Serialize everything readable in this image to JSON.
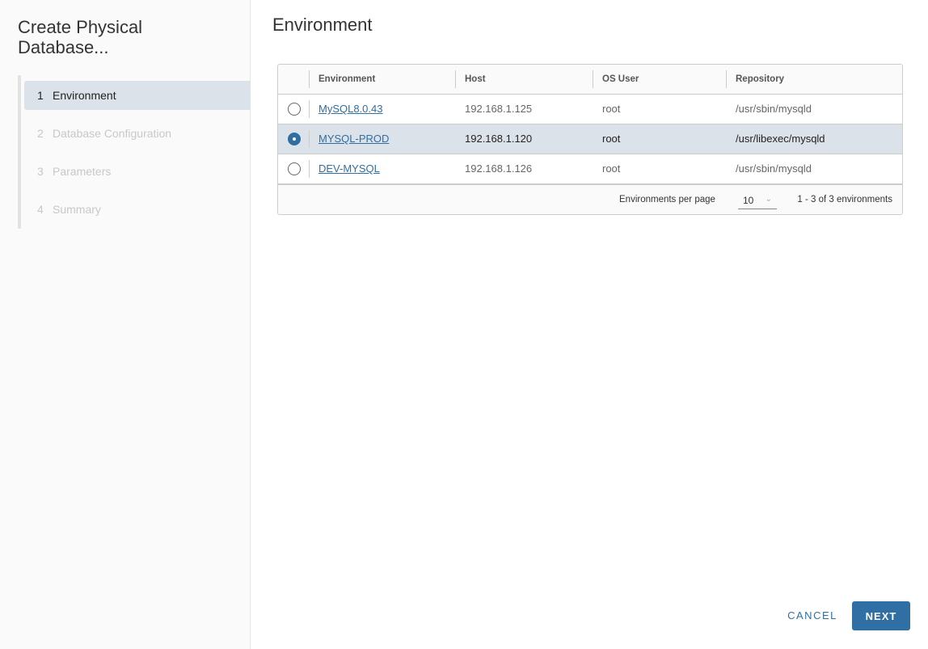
{
  "wizard": {
    "title": "Create Physical Database...",
    "steps": [
      {
        "num": "1",
        "label": "Environment"
      },
      {
        "num": "2",
        "label": "Database Configuration"
      },
      {
        "num": "3",
        "label": "Parameters"
      },
      {
        "num": "4",
        "label": "Summary"
      }
    ]
  },
  "page": {
    "title": "Environment"
  },
  "table": {
    "columns": [
      "Environment",
      "Host",
      "OS User",
      "Repository"
    ],
    "rows": [
      {
        "environment": "MySQL8.0.43",
        "host": "192.168.1.125",
        "os_user": "root",
        "repository": "/usr/sbin/mysqld",
        "selected": false
      },
      {
        "environment": "MYSQL-PROD",
        "host": "192.168.1.120",
        "os_user": "root",
        "repository": "/usr/libexec/mysqld",
        "selected": true
      },
      {
        "environment": "DEV-MYSQL",
        "host": "192.168.1.126",
        "os_user": "root",
        "repository": "/usr/sbin/mysqld",
        "selected": false
      }
    ],
    "footer": {
      "per_page_label": "Environments per page",
      "per_page_value": "10",
      "count": "1 - 3 of 3 environments"
    }
  },
  "buttons": {
    "cancel": "CANCEL",
    "next": "NEXT"
  },
  "colors": {
    "accent": "#2f6fa3",
    "selected_row": "#dbe2ea"
  }
}
